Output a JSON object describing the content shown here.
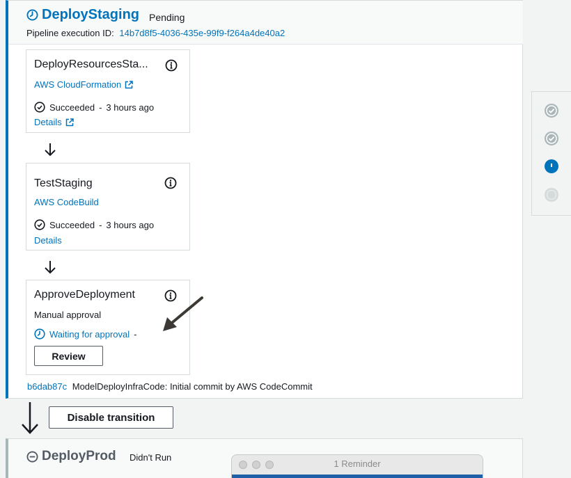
{
  "stage": {
    "name": "DeployStaging",
    "status": "Pending",
    "exec_label": "Pipeline execution ID:",
    "exec_id": "14b7d8f5-4036-435e-99f9-f264a4de40a2"
  },
  "actions": [
    {
      "title": "DeployResourcesSta...",
      "provider": "AWS CloudFormation",
      "status": "Succeeded",
      "sep": "-",
      "time": "3 hours ago",
      "details": "Details"
    },
    {
      "title": "TestStaging",
      "provider": "AWS CodeBuild",
      "status": "Succeeded",
      "sep": "-",
      "time": "3 hours ago",
      "details": "Details"
    },
    {
      "title": "ApproveDeployment",
      "provider": "Manual approval",
      "status": "Waiting for approval",
      "sep": "-",
      "button": "Review"
    }
  ],
  "commit": {
    "id": "b6dab87c",
    "message": "ModelDeployInfraCode: Initial commit by AWS CodeCommit"
  },
  "transition": {
    "button": "Disable transition"
  },
  "next_stage": {
    "name": "DeployProd",
    "status": "Didn't Run"
  },
  "reminder": {
    "title": "1 Reminder"
  },
  "colors": {
    "accent": "#0073bb",
    "success": "#545b64"
  },
  "side_steps": [
    {
      "state": "succeeded",
      "icon": "check-circle-icon"
    },
    {
      "state": "succeeded",
      "icon": "check-circle-icon"
    },
    {
      "state": "in-progress",
      "icon": "progress-dot-icon"
    },
    {
      "state": "not-run",
      "icon": "empty-circle-icon"
    }
  ]
}
